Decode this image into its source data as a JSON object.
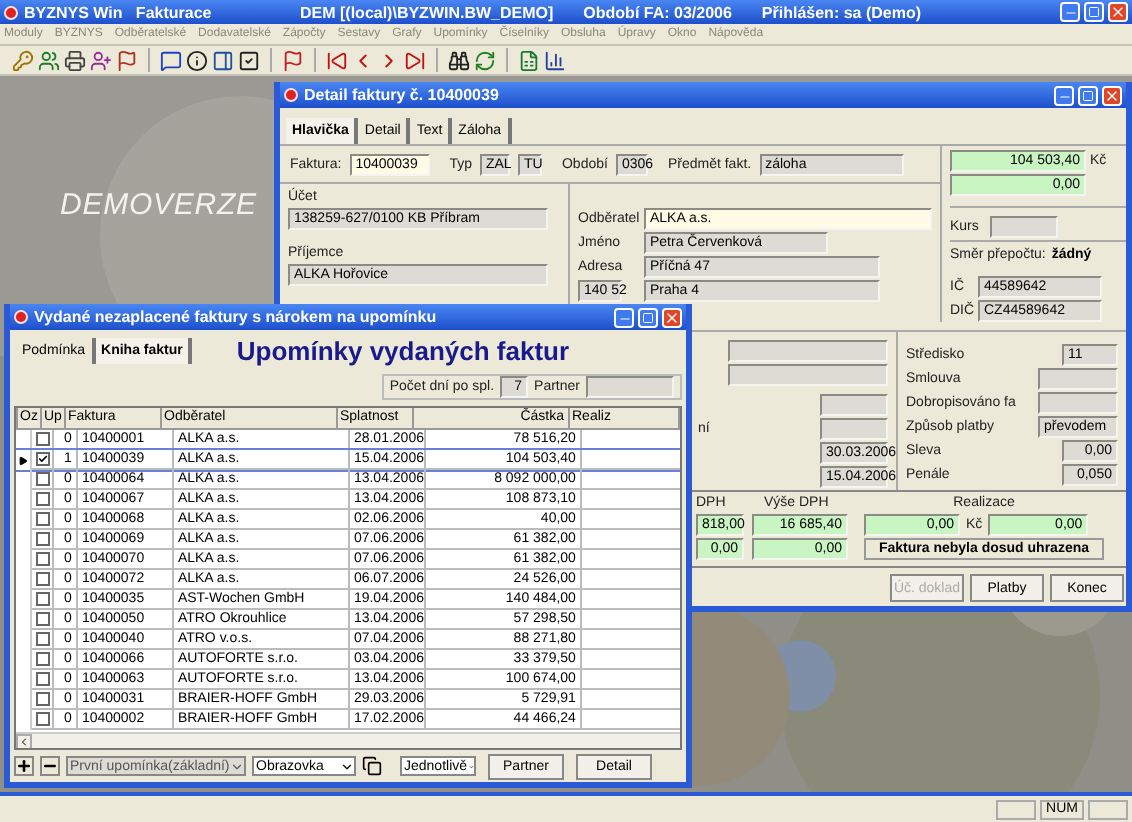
{
  "main_window": {
    "title": "BYZNYS Win   Fakturace",
    "database": "DEM [(local)\\BYZWIN.BW_DEMO]",
    "period": "Období FA: 03/2006",
    "user": "Přihlášen: sa (Demo)"
  },
  "menu": [
    "Moduly",
    "BYZNYS",
    "Odběratelské",
    "Dodavatelské",
    "Zápočty",
    "Sestavy",
    "Grafy",
    "Upomínky",
    "Číselníky",
    "Obsluha",
    "Úpravy",
    "Okno",
    "Nápověda"
  ],
  "desktop": {
    "label": "DEMOVERZE"
  },
  "detail_window": {
    "title": "Detail faktury č. 10400039",
    "tabs": [
      {
        "label": "Hlavička",
        "selected": true
      },
      {
        "label": "Detail",
        "selected": false
      },
      {
        "label": "Text",
        "selected": false
      },
      {
        "label": "Záloha",
        "selected": false
      }
    ],
    "header_fields": [
      {
        "label": "Faktura:",
        "value": "10400039",
        "kind": "key"
      },
      {
        "label": "Typ",
        "value": "ZAL",
        "kind": "plain"
      },
      {
        "value": "TU",
        "kind": "plain"
      },
      {
        "label": "Období",
        "value": "0306",
        "kind": "plain"
      },
      {
        "label": "Předmět fakt.",
        "value": "záloha",
        "kind": "plain"
      }
    ],
    "amounts": [
      {
        "value": "104 503,40",
        "currency": "Kč"
      },
      {
        "value": "0,00"
      }
    ],
    "account": {
      "label": "Účet",
      "value": "138259-627/0100 KB Příbram"
    },
    "recipient": {
      "label": "Příjemce",
      "value": "ALKA Hořovice"
    },
    "customer": [
      {
        "label": "Odběratel",
        "value": "ALKA a.s.",
        "kind": "key"
      },
      {
        "label": "Jméno",
        "value": "Petra Červenková",
        "kind": "plain"
      },
      {
        "label": "Adresa",
        "value": "Příčná 47",
        "kind": "plain"
      }
    ],
    "zip": "140 52",
    "city": "Praha 4",
    "rate_label": "Kurs",
    "conversion": {
      "label": "Směr přepočtu:",
      "value": "žádný"
    },
    "ids": [
      {
        "label": "IČ",
        "value": "44589642"
      },
      {
        "label": "DIČ",
        "value": "CZ44589642"
      }
    ],
    "partial_label": "ní",
    "dates": [
      "30.03.2006",
      "15.04.2006"
    ],
    "right_fields": [
      {
        "label": "Středisko",
        "value": "11"
      },
      {
        "label": "Smlouva"
      },
      {
        "label": "Dobropisováno fa"
      },
      {
        "label": "Způsob platby",
        "value": "převodem"
      },
      {
        "label": "Sleva",
        "value": "0,00"
      },
      {
        "label": "Penále",
        "value": "0,050"
      }
    ],
    "vat": {
      "columns": [
        "DPH",
        "Výše DPH"
      ],
      "rows": [
        [
          "818,00",
          "16 685,40"
        ],
        [
          "0,00",
          "0,00"
        ]
      ]
    },
    "realization": {
      "label": "Realizace",
      "paid": "0,00",
      "currency": "Kč",
      "remaining": "0,00",
      "status": "Faktura nebyla dosud uhrazena"
    },
    "buttons": [
      {
        "label": "Úč. doklad",
        "disabled": true
      },
      {
        "label": "Platby",
        "disabled": false
      },
      {
        "label": "Konec",
        "disabled": false
      }
    ]
  },
  "reminder_window": {
    "title": "Vydané nezaplacené faktury s nárokem na upomínku",
    "tabs": [
      {
        "label": "Podmínka",
        "selected": false
      },
      {
        "label": "Kniha faktur",
        "selected": true
      }
    ],
    "heading": "Upomínky vydaných faktur",
    "days_label": "Počet dní po spl.",
    "days": "7",
    "partner_label": "Partner",
    "checkbox_column": "Oz",
    "columns": [
      "Up",
      "Faktura",
      "Odběratel",
      "Splatnost",
      "Částka",
      "Realiz"
    ],
    "rows": [
      {
        "checked": false,
        "selected": false,
        "cells": [
          "0",
          "10400001",
          "ALKA a.s.",
          "28.01.2006",
          "78 516,20"
        ]
      },
      {
        "checked": true,
        "selected": true,
        "cells": [
          "1",
          "10400039",
          "ALKA a.s.",
          "15.04.2006",
          "104 503,40"
        ]
      },
      {
        "checked": false,
        "selected": false,
        "cells": [
          "0",
          "10400064",
          "ALKA a.s.",
          "13.04.2006",
          "8 092 000,00"
        ]
      },
      {
        "checked": false,
        "selected": false,
        "cells": [
          "0",
          "10400067",
          "ALKA a.s.",
          "13.04.2006",
          "108 873,10"
        ]
      },
      {
        "checked": false,
        "selected": false,
        "cells": [
          "0",
          "10400068",
          "ALKA a.s.",
          "02.06.2006",
          "40,00"
        ]
      },
      {
        "checked": false,
        "selected": false,
        "cells": [
          "0",
          "10400069",
          "ALKA a.s.",
          "07.06.2006",
          "61 382,00"
        ]
      },
      {
        "checked": false,
        "selected": false,
        "cells": [
          "0",
          "10400070",
          "ALKA a.s.",
          "07.06.2006",
          "61 382,00"
        ]
      },
      {
        "checked": false,
        "selected": false,
        "cells": [
          "0",
          "10400072",
          "ALKA a.s.",
          "06.07.2006",
          "24 526,00"
        ]
      },
      {
        "checked": false,
        "selected": false,
        "cells": [
          "0",
          "10400035",
          "AST-Wochen GmbH",
          "19.04.2006",
          "140 484,00"
        ]
      },
      {
        "checked": false,
        "selected": false,
        "cells": [
          "0",
          "10400050",
          "ATRO Okrouhlice",
          "13.04.2006",
          "57 298,50"
        ]
      },
      {
        "checked": false,
        "selected": false,
        "cells": [
          "0",
          "10400040",
          "ATRO v.o.s.",
          "07.04.2006",
          "88 271,80"
        ]
      },
      {
        "checked": false,
        "selected": false,
        "cells": [
          "0",
          "10400066",
          "AUTOFORTE s.r.o.",
          "03.04.2006",
          "33 379,50"
        ]
      },
      {
        "checked": false,
        "selected": false,
        "cells": [
          "0",
          "10400063",
          "AUTOFORTE s.r.o.",
          "13.04.2006",
          "100 674,00"
        ]
      },
      {
        "checked": false,
        "selected": false,
        "cells": [
          "0",
          "10400031",
          "BRAIER-HOFF GmbH",
          "29.03.2006",
          "5 729,91"
        ]
      },
      {
        "checked": false,
        "selected": false,
        "cells": [
          "0",
          "10400002",
          "BRAIER-HOFF GmbH",
          "17.02.2006",
          "44 466,24"
        ]
      }
    ],
    "template": "První upomínka(základní)",
    "output": "Obrazovka",
    "mode": "Jednotlivě",
    "buttons": [
      "Partner",
      "Detail"
    ]
  },
  "status_bar": {
    "num": "NUM"
  }
}
